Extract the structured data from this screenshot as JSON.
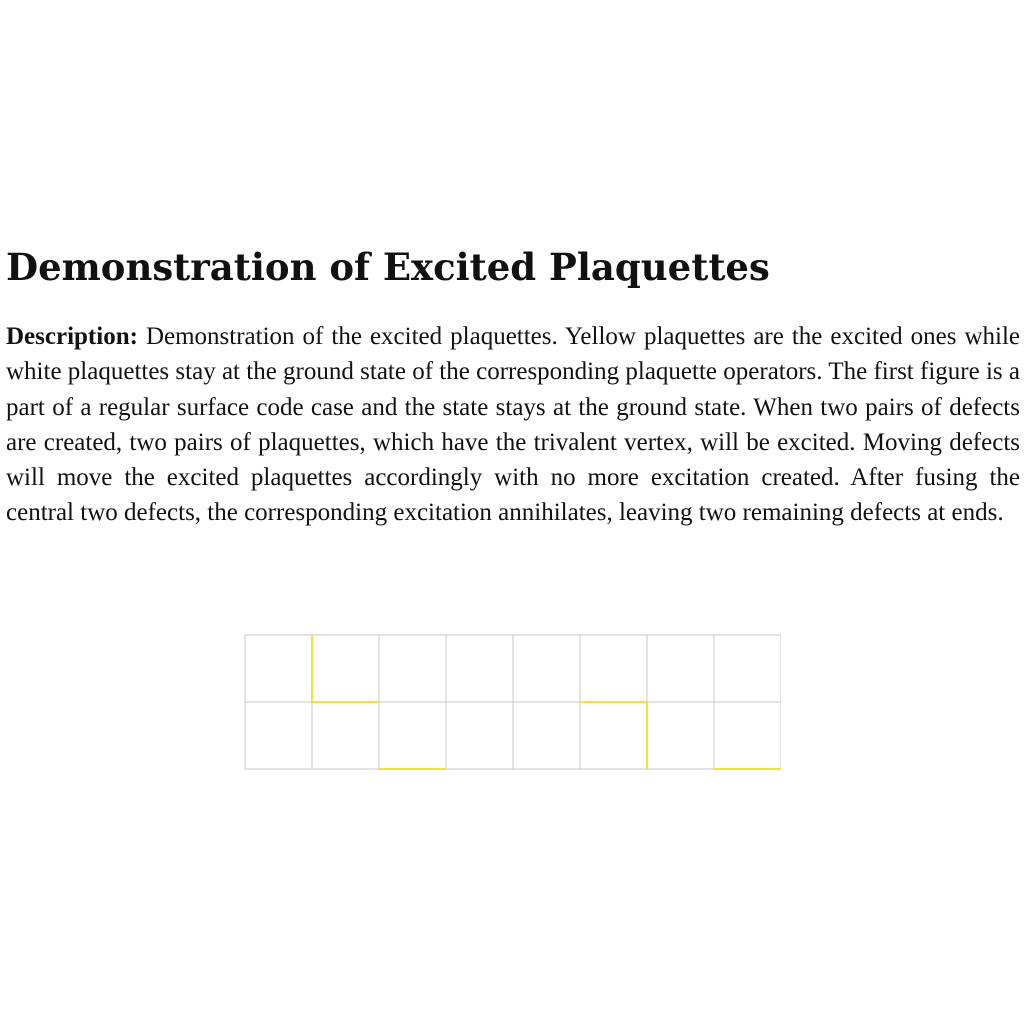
{
  "title": "Demonstration of Excited Plaquettes",
  "description": {
    "label": "Description:",
    "text": "Demonstration of the excited plaquettes. Yellow plaquettes are the excited ones while white plaquettes stay at the ground state of the cor­responding plaquette operators. The first figure is a part of a regular surface code case and the state stays at the ground state. When two pairs of defects are created, two pairs of plaquettes, which have the trivalent vertex, will be excited. Moving defects will move the excited plaquettes accordingly with no more excitation created. After fusing the central two defects, the corresponding excitation annihilates, leaving two remaining defects at ends."
  },
  "figure": {
    "rows": 2,
    "columns": 8,
    "grid_color": "#c8c8c8",
    "highlight_color": "#f2e23a",
    "highlighted_edges": [
      {
        "orientation": "vertical",
        "row": 0,
        "col": 1
      },
      {
        "orientation": "horizontal",
        "row": 1,
        "col": 1
      },
      {
        "orientation": "horizontal",
        "row": 2,
        "col": 2
      },
      {
        "orientation": "horizontal",
        "row": 1,
        "col": 5
      },
      {
        "orientation": "vertical",
        "row": 1,
        "col": 6
      },
      {
        "orientation": "horizontal",
        "row": 2,
        "col": 7
      }
    ]
  }
}
